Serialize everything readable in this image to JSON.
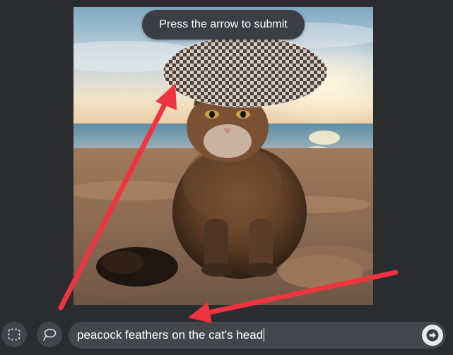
{
  "tooltip": {
    "text": "Press the arrow to submit"
  },
  "toolbar": {
    "rect_select_icon": "rectangle-selection-icon",
    "lasso_icon": "lasso-icon"
  },
  "prompt": {
    "value": "peacock feathers on the cat's head",
    "submit_icon": "arrow-right-icon"
  },
  "colors": {
    "background": "#2b2c30",
    "annotation_arrow": "#f0343f",
    "prompt_bar": "#45464c",
    "submit_button": "#e9e9ec"
  }
}
